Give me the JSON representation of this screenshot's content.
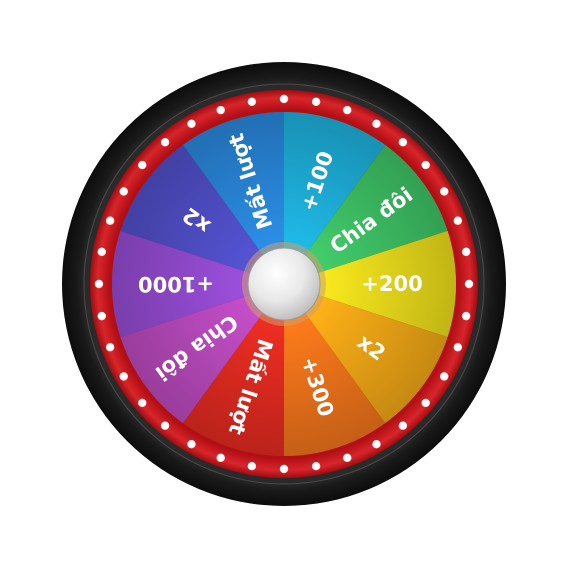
{
  "game": {
    "name": "prize-wheel",
    "colors": {
      "background": "#ffffff",
      "outer_rim": "#1c1c1c",
      "red_ring": "#c8141a",
      "bulb": "#ffffff",
      "hub": "#eeeeee"
    },
    "bulb_count": 36,
    "segments": [
      {
        "label": "+100",
        "color": "#1fb9e6"
      },
      {
        "label": "Chia đôi",
        "color": "#41cc6a"
      },
      {
        "label": "+200",
        "color": "#f7e81c"
      },
      {
        "label": "x2",
        "color": "#fdb017"
      },
      {
        "label": "+300",
        "color": "#fc7a1c"
      },
      {
        "label": "Mất lượt",
        "color": "#ee2d22"
      },
      {
        "label": "Chia đôi",
        "color": "#c44ec8"
      },
      {
        "label": "+1000",
        "color": "#9b4fdc"
      },
      {
        "label": "x2",
        "color": "#5453d2"
      },
      {
        "label": "Mất lượt",
        "color": "#2b8ee6"
      }
    ]
  }
}
